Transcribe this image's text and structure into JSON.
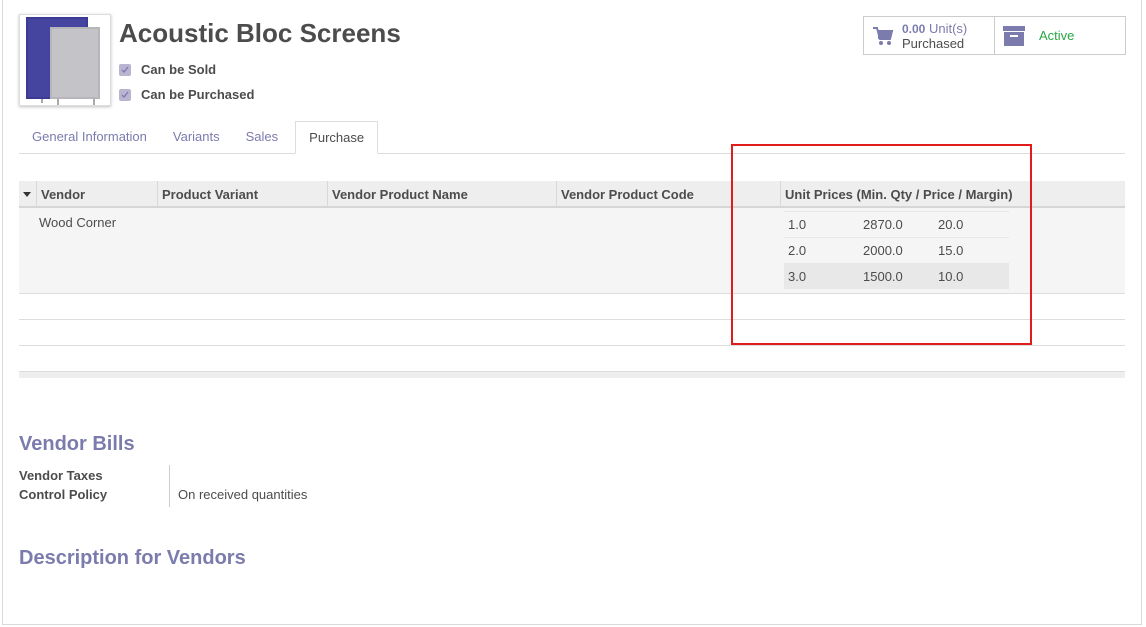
{
  "product": {
    "name": "Acoustic Bloc Screens",
    "can_be_sold": "Can be Sold",
    "can_be_purchased": "Can be Purchased",
    "image_icon": "product-image"
  },
  "stats": {
    "purchased_value": "0.00",
    "purchased_unit": "Unit(s)",
    "purchased_label": "Purchased",
    "purchased_icon": "cart-icon",
    "active_label": "Active",
    "active_icon": "archive-icon"
  },
  "tabs": [
    {
      "label": "General Information"
    },
    {
      "label": "Variants"
    },
    {
      "label": "Sales"
    },
    {
      "label": "Purchase"
    }
  ],
  "vendor_table": {
    "columns": [
      "Vendor",
      "Product Variant",
      "Vendor Product Name",
      "Vendor Product Code",
      "Unit Prices (Min. Qty / Price / Margin)"
    ],
    "rows": [
      {
        "vendor": "Wood Corner",
        "variant": "",
        "vendor_product_name": "",
        "vendor_product_code": "",
        "prices": [
          {
            "qty": "1.0",
            "price": "2870.0",
            "margin": "20.0"
          },
          {
            "qty": "2.0",
            "price": "2000.0",
            "margin": "15.0"
          },
          {
            "qty": "3.0",
            "price": "1500.0",
            "margin": "10.0"
          }
        ]
      }
    ]
  },
  "vendor_bills": {
    "title": "Vendor Bills",
    "taxes_label": "Vendor Taxes",
    "taxes_value": "",
    "control_label": "Control Policy",
    "control_value": "On received quantities"
  },
  "description": {
    "title": "Description for Vendors"
  },
  "colors": {
    "accent": "#7c7bad",
    "active": "#28a745",
    "highlight": "#e21b1b"
  }
}
